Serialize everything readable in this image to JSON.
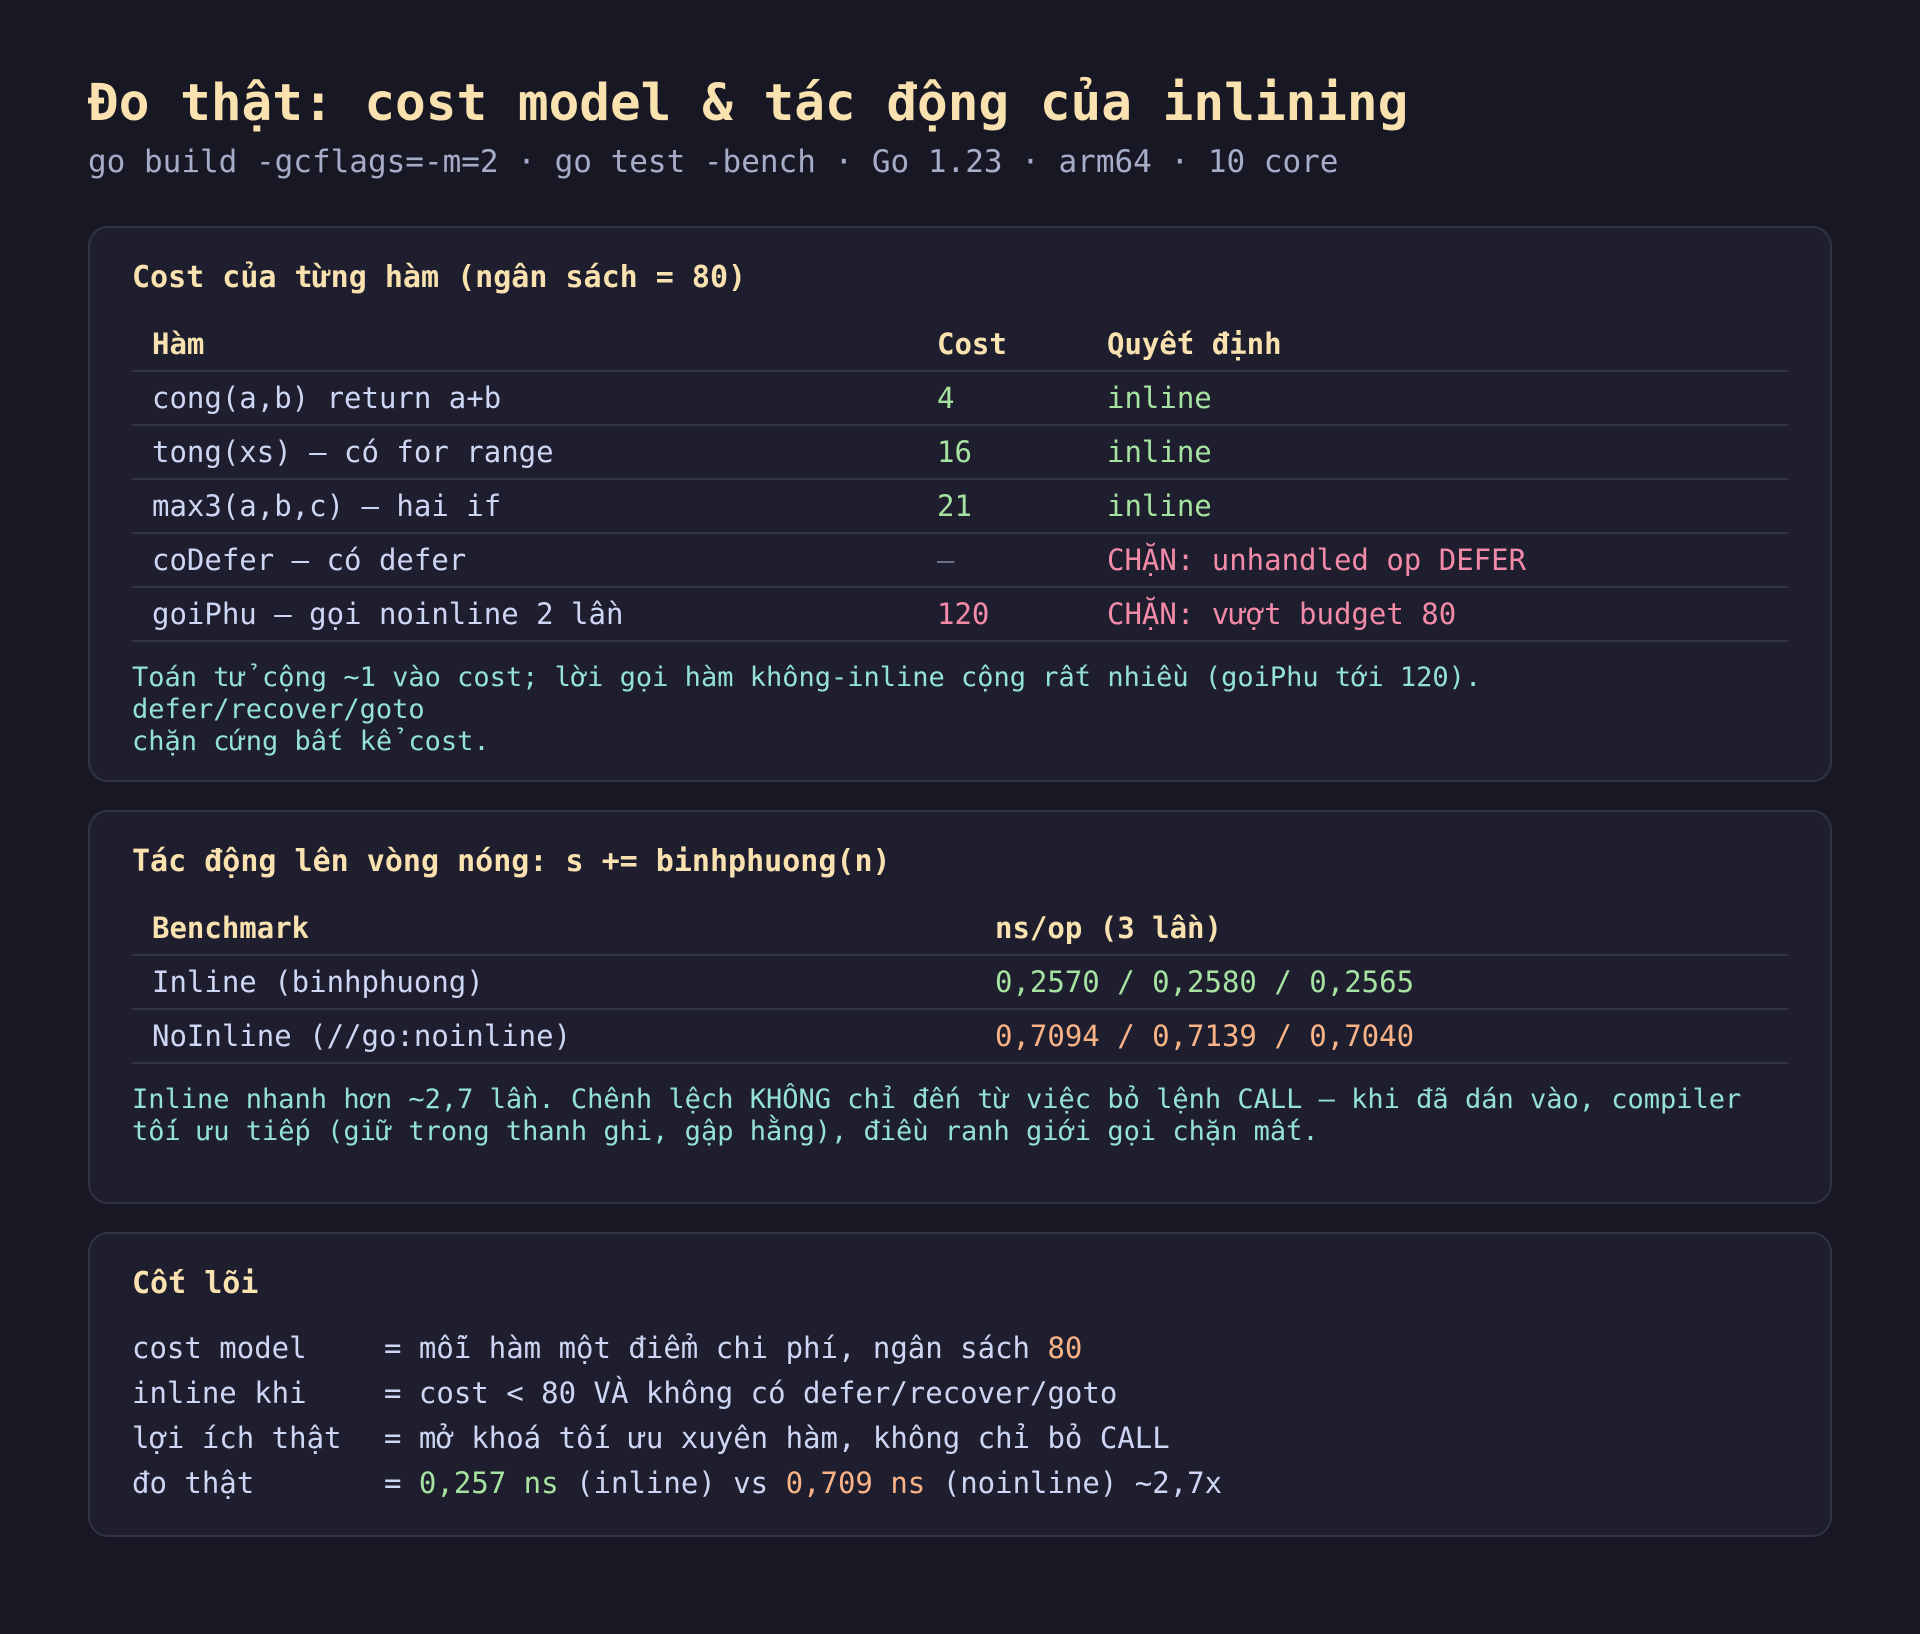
{
  "header": {
    "title": "Đo thật: cost model & tác động của inlining",
    "subtitle": "go build -gcflags=-m=2 · go test -bench · Go 1.23 · arm64 · 10 core"
  },
  "cost_section": {
    "title": "Cost của từng hàm (ngân sách = 80)",
    "columns": [
      "Hàm",
      "Cost",
      "Quyết định"
    ],
    "rows": [
      {
        "name": "cong(a,b) return a+b",
        "cost": "4",
        "decision": "inline",
        "status": "ok"
      },
      {
        "name": "tong(xs) — có for range",
        "cost": "16",
        "decision": "inline",
        "status": "ok"
      },
      {
        "name": "max3(a,b,c) — hai if",
        "cost": "21",
        "decision": "inline",
        "status": "ok"
      },
      {
        "name": "coDefer — có defer",
        "cost": "—",
        "decision": "CHẶN: unhandled op DEFER",
        "status": "blocked"
      },
      {
        "name": "goiPhu — gọi noinline 2 lần",
        "cost": "120",
        "decision": "CHẶN: vượt budget 80",
        "status": "blocked"
      }
    ],
    "note": "Toán tử cộng ~1 vào cost; lời gọi hàm không-inline cộng rất nhiều (goiPhu tới 120). defer/recover/goto\nchặn cứng bất kể cost."
  },
  "bench_section": {
    "title": "Tác động lên vòng nóng: s += binhphuong(n)",
    "columns": [
      "Benchmark",
      "ns/op (3 lần)"
    ],
    "rows": [
      {
        "name": "Inline (binhphuong)",
        "result": "0,2570 / 0,2580 / 0,2565",
        "tone": "fast"
      },
      {
        "name": "NoInline (//go:noinline)",
        "result": "0,7094 / 0,7139 / 0,7040",
        "tone": "slow"
      }
    ],
    "note": "Inline nhanh hơn ~2,7 lần. Chênh lệch KHÔNG chỉ đến từ việc bỏ lệnh CALL — khi đã dán vào, compiler\ntối ưu tiếp (giữ trong thanh ghi, gập hằng), điều ranh giới gọi chặn mất."
  },
  "core_section": {
    "title": "Cốt lõi",
    "lines": [
      {
        "key": "cost model",
        "prefix": "= mỗi hàm một điểm chi phí, ngân sách ",
        "highlight": "80"
      },
      {
        "key": "inline khi",
        "text": "= cost < 80 VÀ không có defer/recover/goto"
      },
      {
        "key": "lợi ích thật",
        "text": "= mở khoá tối ưu xuyên hàm, không chỉ bỏ CALL"
      },
      {
        "key": "đo thật",
        "eq": "= ",
        "fast": "0,257 ns",
        "mid": " (inline) vs ",
        "slow": "0,709 ns",
        "tail": " (noinline) ~2,7x"
      }
    ]
  }
}
